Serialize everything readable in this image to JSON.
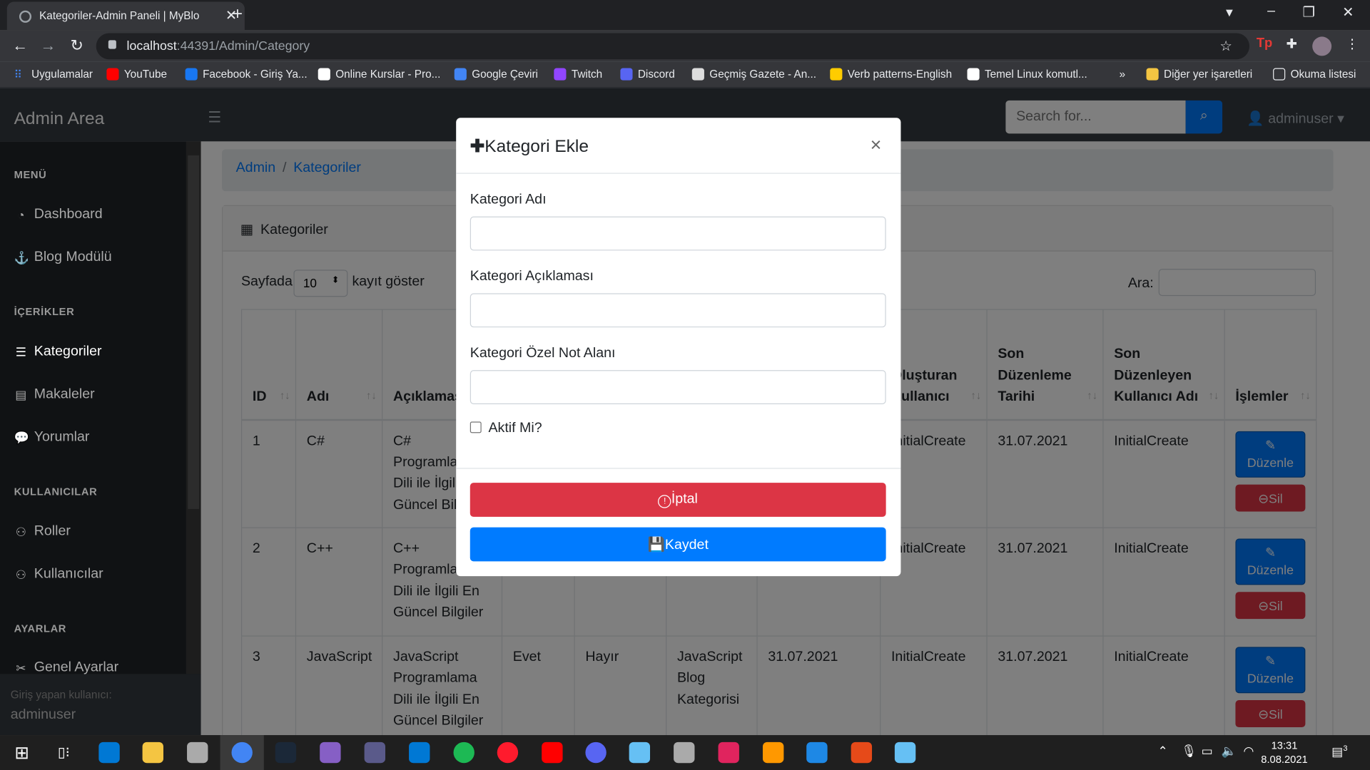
{
  "browser": {
    "tab_title": "Kategoriler-Admin Paneli | MyBlo",
    "url_host": "localhost",
    "url_path": ":44391/Admin/Category",
    "bookmarks": [
      "Uygulamalar",
      "YouTube",
      "Facebook - Giriş Ya...",
      "Online Kurslar - Pro...",
      "Google Çeviri",
      "Twitch",
      "Discord",
      "Geçmiş Gazete - An...",
      "Verb patterns-English",
      "Temel Linux komutl..."
    ],
    "bookmark_more": "»",
    "other_bookmarks": "Diğer yer işaretleri",
    "reading_list": "Okuma listesi",
    "bookmark_colors": [
      "#ea4335",
      "#ff0000",
      "#1877f2",
      "#ffffff",
      "#4285f4",
      "#9146ff",
      "#5865f2",
      "#dddddd",
      "#ffcc00",
      "#ffffff"
    ]
  },
  "topnav": {
    "brand": "Admin Area",
    "search_placeholder": "Search for...",
    "user": "adminuser"
  },
  "sidebar": {
    "sections": [
      {
        "heading": "MENÜ",
        "items": [
          "Dashboard",
          "Blog Modülü"
        ]
      },
      {
        "heading": "İÇERİKLER",
        "items": [
          "Kategoriler",
          "Makaleler",
          "Yorumlar"
        ]
      },
      {
        "heading": "KULLANICILAR",
        "items": [
          "Roller",
          "Kullanıcılar"
        ]
      },
      {
        "heading": "AYARLAR",
        "items": [
          "Genel Ayarlar"
        ]
      }
    ],
    "footer_label": "Giriş yapan kullanıcı:",
    "footer_user": "adminuser"
  },
  "breadcrumb": [
    "Admin",
    "Kategoriler"
  ],
  "card_title": "Kategoriler",
  "table_controls": {
    "show_prefix": "Sayfada",
    "page_size": "10",
    "show_suffix": "kayıt göster",
    "search_label": "Ara:"
  },
  "table": {
    "headers": [
      "ID",
      "Adı",
      "Açıklaması",
      "",
      "",
      "",
      "",
      "Oluşturan Kullanıcı",
      "Son Düzenleme Tarihi",
      "Son Düzenleyen Kullanıcı Adı",
      "İşlemler"
    ],
    "rows": [
      [
        "1",
        "C#",
        "C# Programlama Dili ile İlgili En Güncel Bilgiler",
        "",
        "",
        "",
        "",
        "InitialCreate",
        "31.07.2021",
        "InitialCreate"
      ],
      [
        "2",
        "C++",
        "C++ Programlama Dili ile İlgili En Güncel Bilgiler",
        "",
        "",
        "",
        "",
        "InitialCreate",
        "31.07.2021",
        "InitialCreate"
      ],
      [
        "3",
        "JavaScript",
        "JavaScript Programlama Dili ile İlgili En Güncel Bilgiler",
        "Evet",
        "Hayır",
        "JavaScript Blog Kategorisi",
        "31.07.2021",
        "InitialCreate",
        "31.07.2021",
        "InitialCreate"
      ]
    ],
    "edit_label": "Düzenle",
    "delete_label": "Sil"
  },
  "modal": {
    "title": "Kategori Ekle",
    "close": "×",
    "name_label": "Kategori Adı",
    "desc_label": "Kategori Açıklaması",
    "note_label": "Kategori Özel Not Alanı",
    "active_label": "Aktif Mi?",
    "cancel_label": "İptal",
    "save_label": "Kaydet"
  },
  "taskbar": {
    "time": "13:31",
    "date": "8.08.2021",
    "notifications": "3",
    "app_colors": [
      "#4285f4",
      "#ffffff",
      "#0078d4",
      "#f4c542",
      "#1e88e5",
      "#ea4335",
      "#1b2838",
      "#865fc5",
      "#5a5a8a",
      "#0078d4",
      "#1db954",
      "#ff1b2d",
      "#ff0000",
      "#5865f2",
      "#ffffff",
      "#aaaaaa",
      "#e0245e",
      "#ff9800",
      "#1e88e5",
      "#e64a19",
      "#66c0f4"
    ]
  }
}
